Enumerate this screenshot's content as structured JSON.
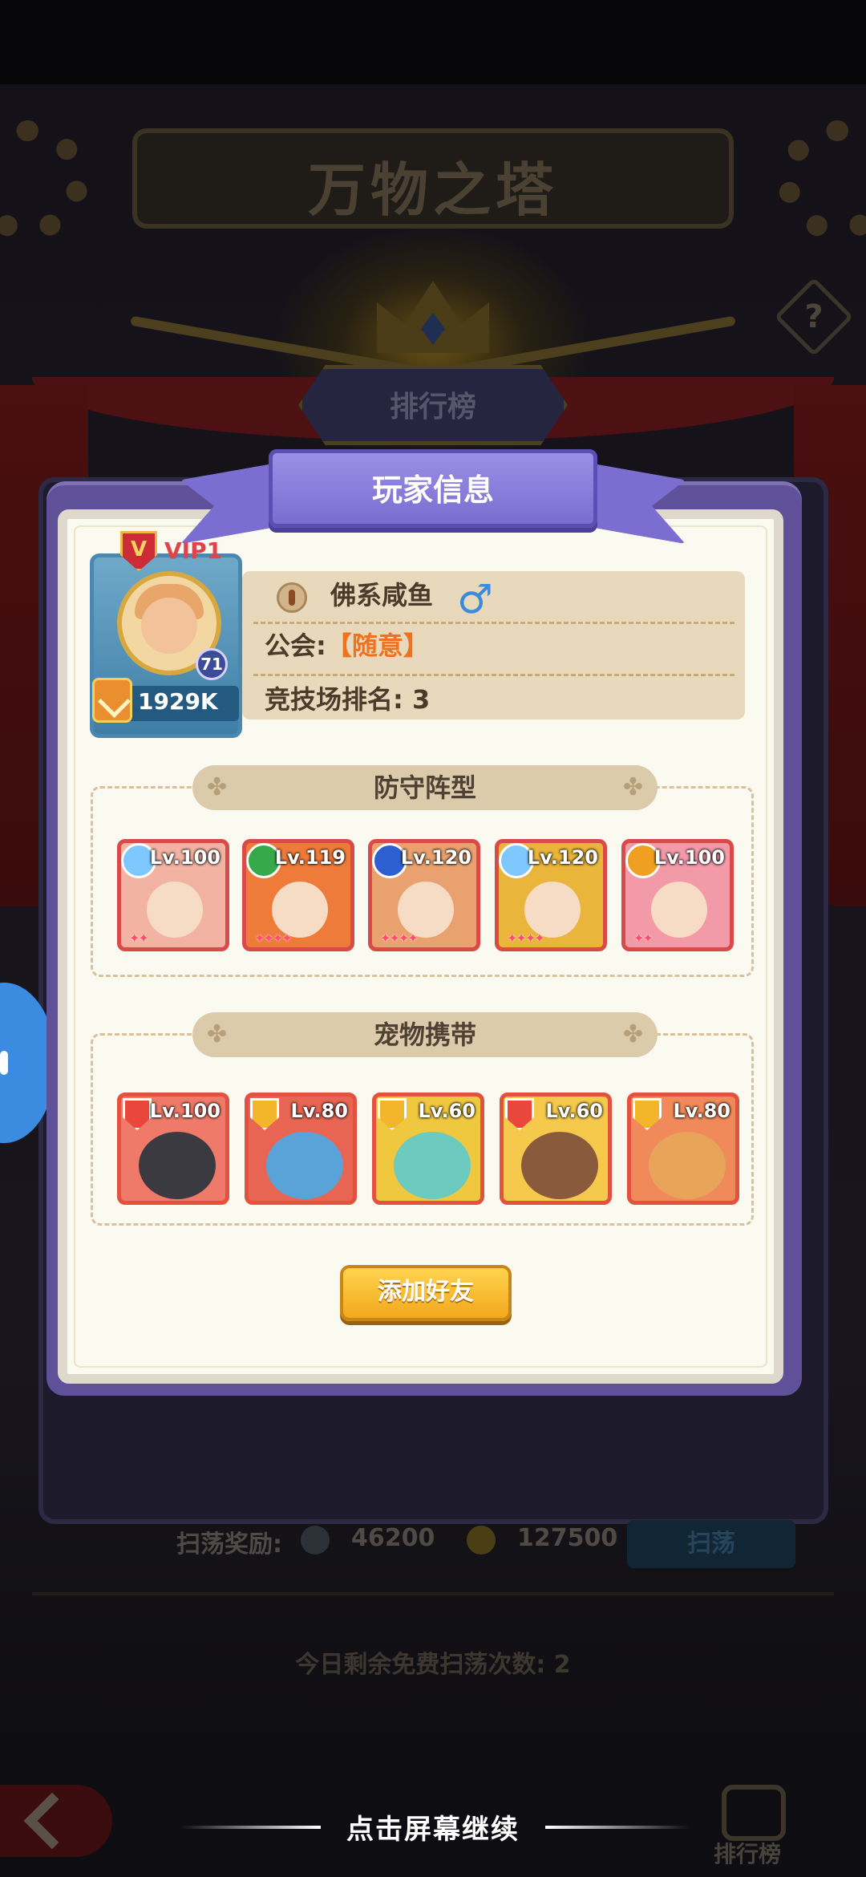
{
  "background": {
    "title": "万物之塔",
    "rank_button": "排行榜",
    "help_icon": "?",
    "sweep_reward_label": "扫荡奖励:",
    "sweep_value_1": "46200",
    "sweep_value_2": "127500",
    "sweep_button": "扫荡",
    "free_sweeps": "今日剩余免费扫荡次数: 2",
    "bottom_rank_label": "排行榜"
  },
  "modal": {
    "title": "玩家信息",
    "player": {
      "vip_icon": "V",
      "vip": "VIP1",
      "level": "71",
      "power": "1929K",
      "name": "佛系咸鱼",
      "gender_icon": "♂",
      "guild_label": "公会:",
      "guild_value": "【随意】",
      "arena_label": "竞技场排名:",
      "arena_value": "3"
    },
    "defense": {
      "title": "防守阵型",
      "heroes": [
        {
          "level": "Lv.100",
          "element": "light",
          "elem_color": "#7fc7ff",
          "bg": "#f3b3a2",
          "stars": "✦✦"
        },
        {
          "level": "Lv.119",
          "element": "nature",
          "elem_color": "#36a94a",
          "bg": "#ef7b3a",
          "stars": "✦✦✦✦"
        },
        {
          "level": "Lv.120",
          "element": "water",
          "elem_color": "#2d5fd1",
          "bg": "#e9a26f",
          "stars": "✦✦✦✦"
        },
        {
          "level": "Lv.120",
          "element": "light",
          "elem_color": "#7fc7ff",
          "bg": "#e9b53a",
          "stars": "✦✦✦✦"
        },
        {
          "level": "Lv.100",
          "element": "fire",
          "elem_color": "#f0a020",
          "bg": "#f39aa8",
          "stars": "✦✦"
        }
      ]
    },
    "pets": {
      "title": "宠物携带",
      "items": [
        {
          "level": "Lv.100",
          "badge_color": "#e9473b",
          "bg": "#f07a6a",
          "face": "#3a3a40"
        },
        {
          "level": "Lv.80",
          "badge_color": "#f2b52c",
          "bg": "#e86553",
          "face": "#5aa3d8"
        },
        {
          "level": "Lv.60",
          "badge_color": "#f2b52c",
          "bg": "#f0c840",
          "face": "#6ccabf"
        },
        {
          "level": "Lv.60",
          "badge_color": "#e9473b",
          "bg": "#f5c94c",
          "face": "#8a5a3c"
        },
        {
          "level": "Lv.80",
          "badge_color": "#f2b52c",
          "bg": "#f08a5a",
          "face": "#e8a458"
        }
      ]
    },
    "add_friend": "添加好友"
  },
  "continue_hint": "点击屏幕继续"
}
